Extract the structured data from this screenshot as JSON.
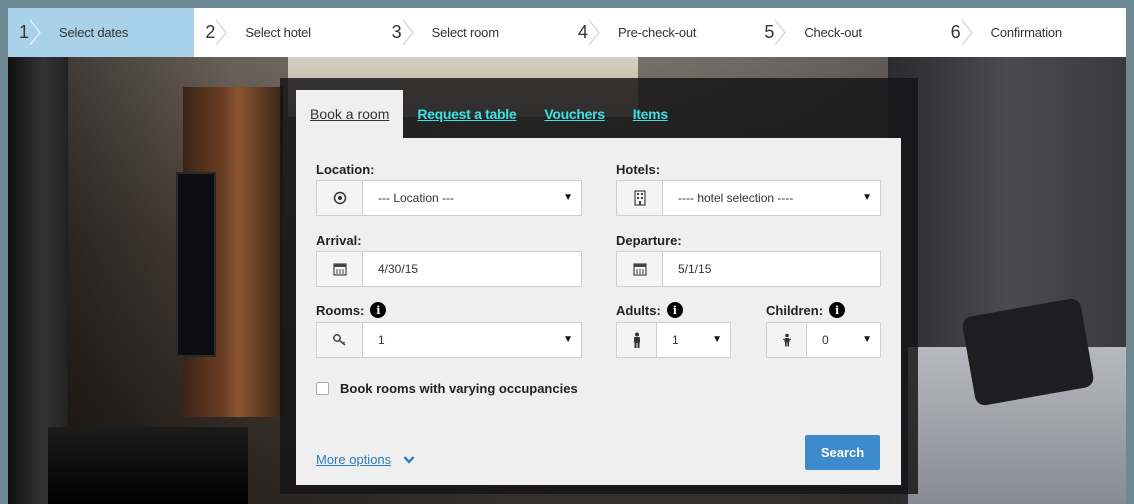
{
  "steps": [
    {
      "num": "1",
      "label": "Select dates"
    },
    {
      "num": "2",
      "label": "Select hotel"
    },
    {
      "num": "3",
      "label": "Select room"
    },
    {
      "num": "4",
      "label": "Pre-check-out"
    },
    {
      "num": "5",
      "label": "Check-out"
    },
    {
      "num": "6",
      "label": "Confirmation"
    }
  ],
  "active_step": 1,
  "tabs": {
    "book_room": "Book a room",
    "request_table": "Request a table",
    "vouchers": "Vouchers",
    "items": "Items"
  },
  "form": {
    "location_label": "Location:",
    "location_value": "--- Location ---",
    "hotels_label": "Hotels:",
    "hotels_value": "---- hotel selection ----",
    "arrival_label": "Arrival:",
    "arrival_value": "4/30/15",
    "departure_label": "Departure:",
    "departure_value": "5/1/15",
    "rooms_label": "Rooms:",
    "rooms_value": "1",
    "adults_label": "Adults:",
    "adults_value": "1",
    "children_label": "Children:",
    "children_value": "0",
    "varying_label": "Book rooms with varying occupancies",
    "more_options": "More options",
    "search": "Search"
  },
  "colors": {
    "active_step": "#a9d2ea",
    "tab_link": "#3fe0e4",
    "search_button": "#3d8bcd"
  }
}
